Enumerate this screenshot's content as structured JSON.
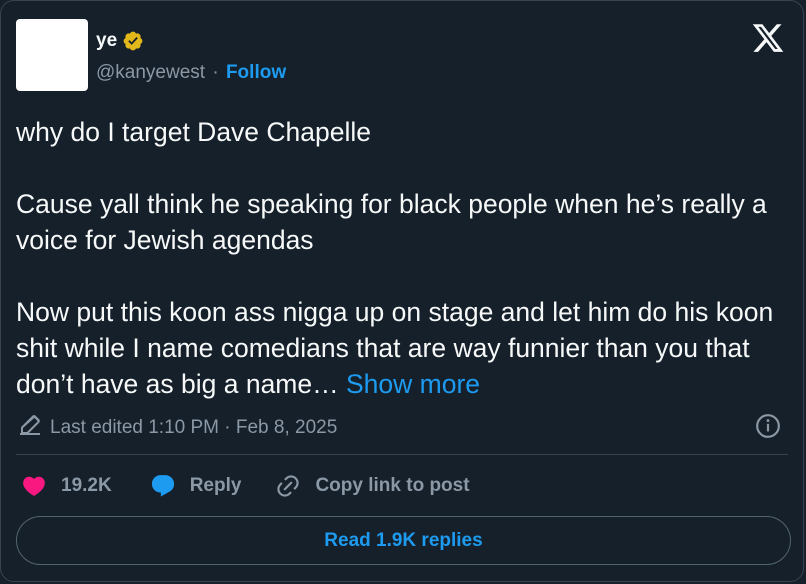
{
  "author": {
    "name": "ye",
    "handle": "@kanyewest",
    "separator": "·",
    "follow_label": "Follow"
  },
  "tweet": {
    "text": "why do I target Dave Chapelle\n\nCause yall think he speaking for black people when he’s really a voice for Jewish agendas\n\nNow put this koon ass nigga up on stage and let him do his koon shit while I name comedians that are way funnier than you that don’t have as big a name… ",
    "show_more_label": "Show more",
    "edited_label": "Last edited 1:10 PM · Feb 8, 2025"
  },
  "actions": {
    "likes": "19.2K",
    "reply_label": "Reply",
    "copy_link_label": "Copy link to post"
  },
  "read_replies_label": "Read 1.9K replies",
  "colors": {
    "background": "#15202b",
    "accent": "#1d9bf0",
    "like": "#f91880",
    "muted": "#8b98a5",
    "verified": "#e2b719"
  }
}
